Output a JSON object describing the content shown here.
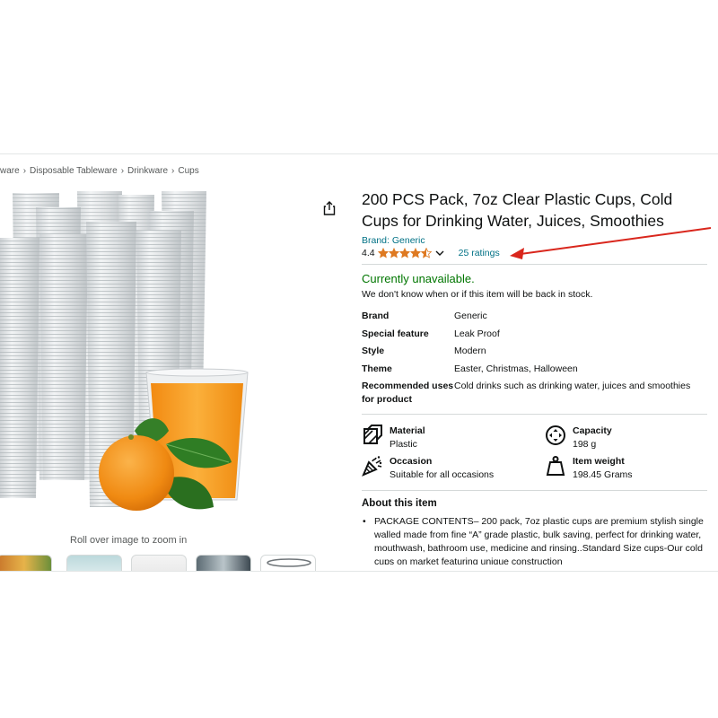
{
  "breadcrumb": [
    {
      "label": "ware"
    },
    {
      "label": "Disposable Tableware"
    },
    {
      "label": "Drinkware"
    },
    {
      "label": "Cups"
    }
  ],
  "breadcrumb_separator": "›",
  "gallery": {
    "zoom_hint": "Roll over image to zoom in",
    "main_image_icon": "stacked-clear-plastic-cups-with-orange-juice-photo"
  },
  "share": {
    "icon": "share-icon"
  },
  "product": {
    "title": "200 PCS Pack, 7oz Clear Plastic Cups, Cold Cups for Drinking Water, Juices, Smoothies",
    "brand": "Brand: Generic",
    "rating_value": "4.4",
    "rating_stars": 4.4,
    "ratings_link": "25 ratings",
    "availability": "Currently unavailable.",
    "stock_note": "We don't know when or if this item will be back in stock."
  },
  "specs": [
    {
      "key": "Brand",
      "value": "Generic"
    },
    {
      "key": "Special feature",
      "value": "Leak Proof"
    },
    {
      "key": "Style",
      "value": "Modern"
    },
    {
      "key": "Theme",
      "value": "Easter, Christmas, Halloween"
    },
    {
      "key": "Recommended uses for product",
      "value": "Cold drinks such as drinking water, juices and smoothies"
    }
  ],
  "attributes": [
    {
      "icon": "material-icon",
      "label": "Material",
      "value": "Plastic"
    },
    {
      "icon": "capacity-icon",
      "label": "Capacity",
      "value": "198 g"
    },
    {
      "icon": "occasion-icon",
      "label": "Occasion",
      "value": "Suitable for all occasions"
    },
    {
      "icon": "item-weight-icon",
      "label": "Item weight",
      "value": "198.45 Grams"
    }
  ],
  "about": {
    "heading": "About this item",
    "bullets": [
      "PACKAGE CONTENTS– 200 pack, 7oz plastic cups are premium stylish single walled made from fine “A” grade plastic, bulk saving, perfect for drinking water, mouthwash, bathroom use, medicine and rinsing..Standard Size cups-Our cold cups on market featuring unique construction"
    ]
  },
  "colors": {
    "link": "#007185",
    "availability": "#007600",
    "star": "#DE7921",
    "annotation_arrow": "#D9261C"
  }
}
